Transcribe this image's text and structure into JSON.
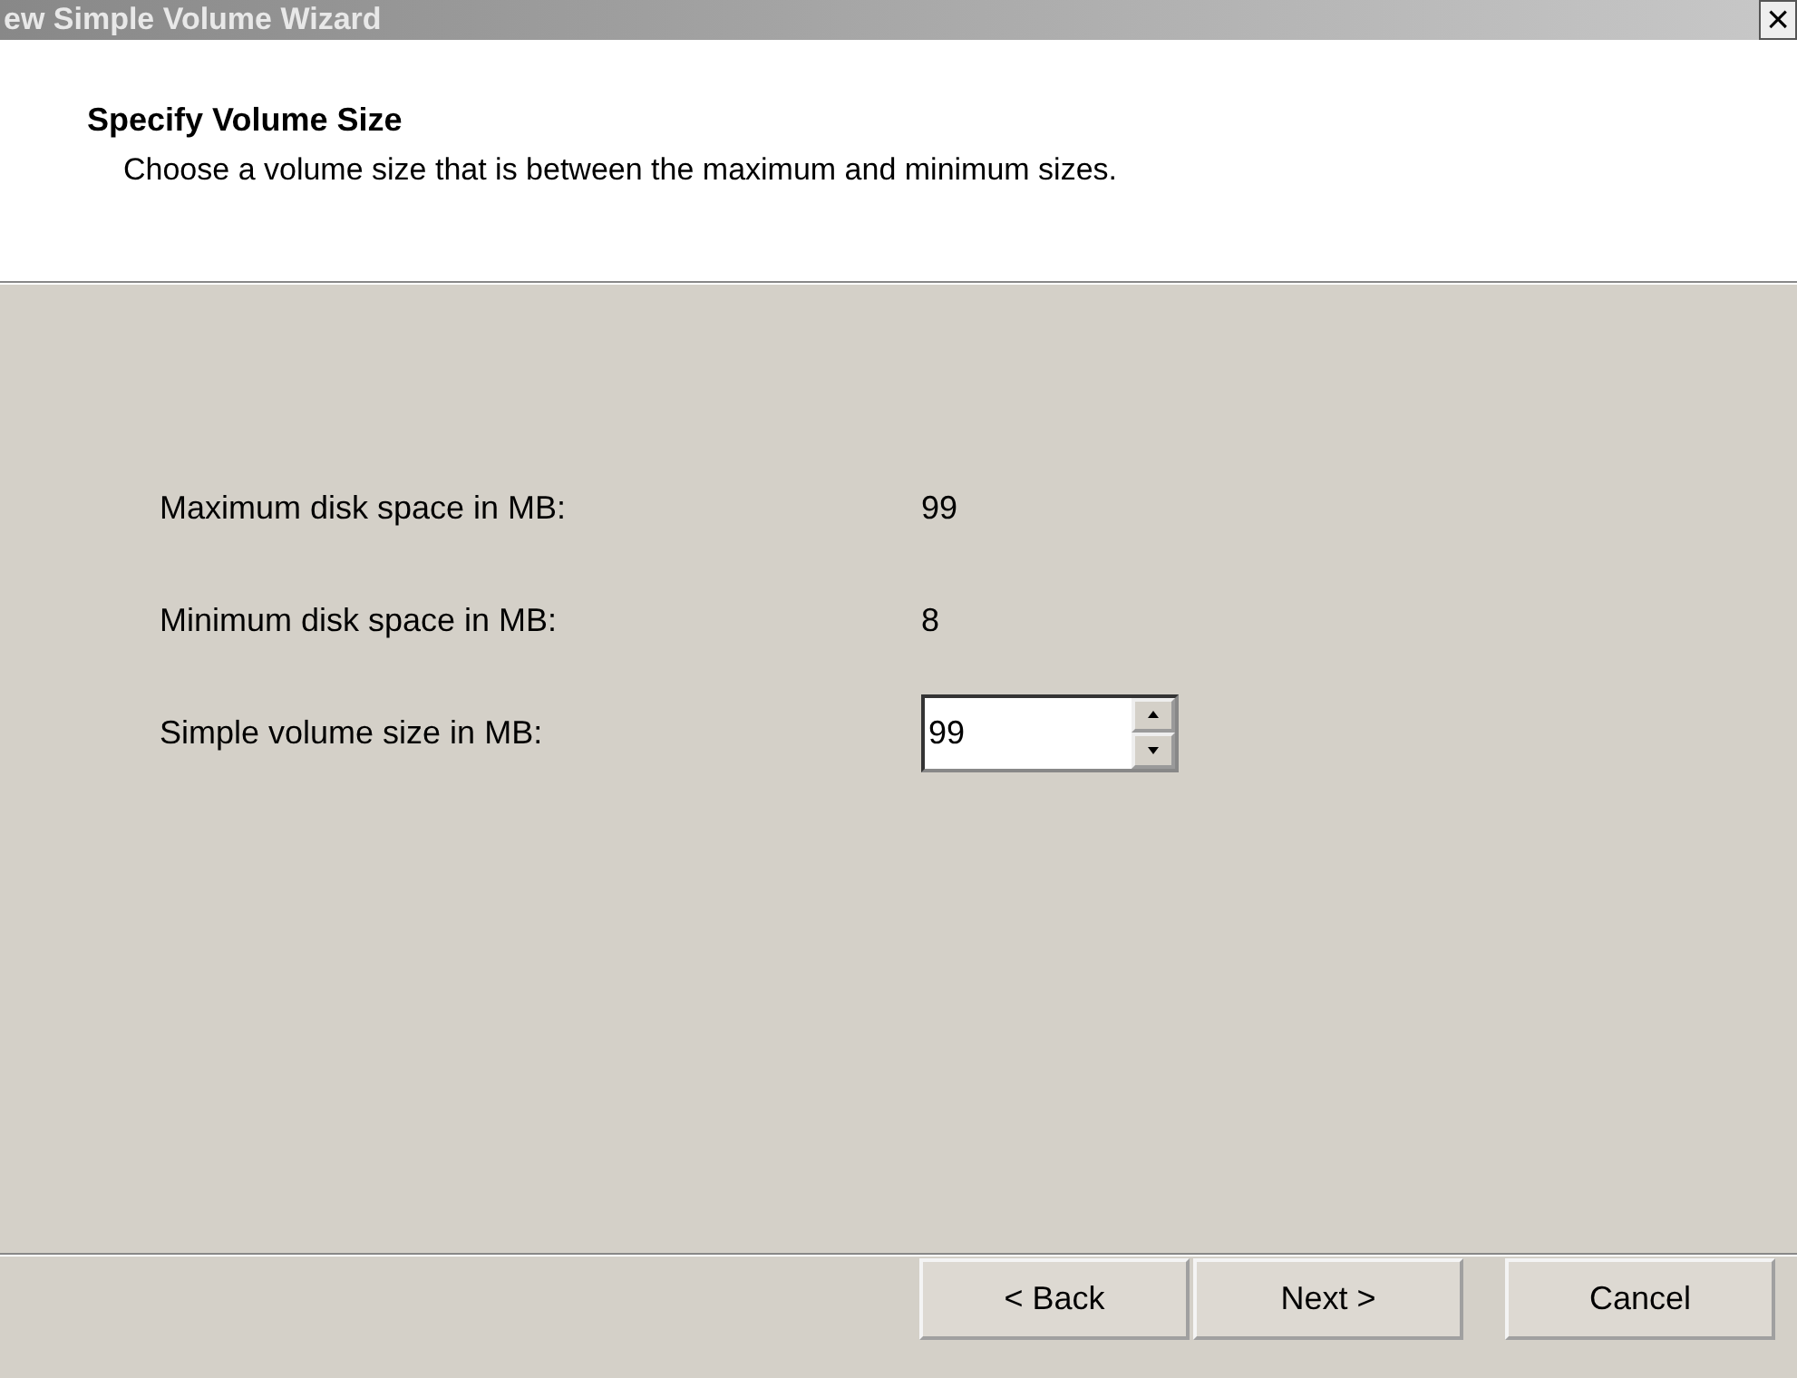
{
  "window": {
    "title": "ew Simple Volume Wizard",
    "close": "×"
  },
  "header": {
    "title": "Specify Volume Size",
    "subtitle": "Choose a volume size that is between the maximum and minimum sizes."
  },
  "fields": [
    {
      "kind": "readout",
      "label": "Maximum disk space in MB:",
      "value": "99"
    },
    {
      "kind": "readout",
      "label": "Minimum disk space in MB:",
      "value": "8"
    },
    {
      "kind": "spin",
      "label": "Simple volume size in MB:",
      "value": "99"
    }
  ],
  "buttons": [
    "< Back",
    "Next >",
    "Cancel"
  ]
}
